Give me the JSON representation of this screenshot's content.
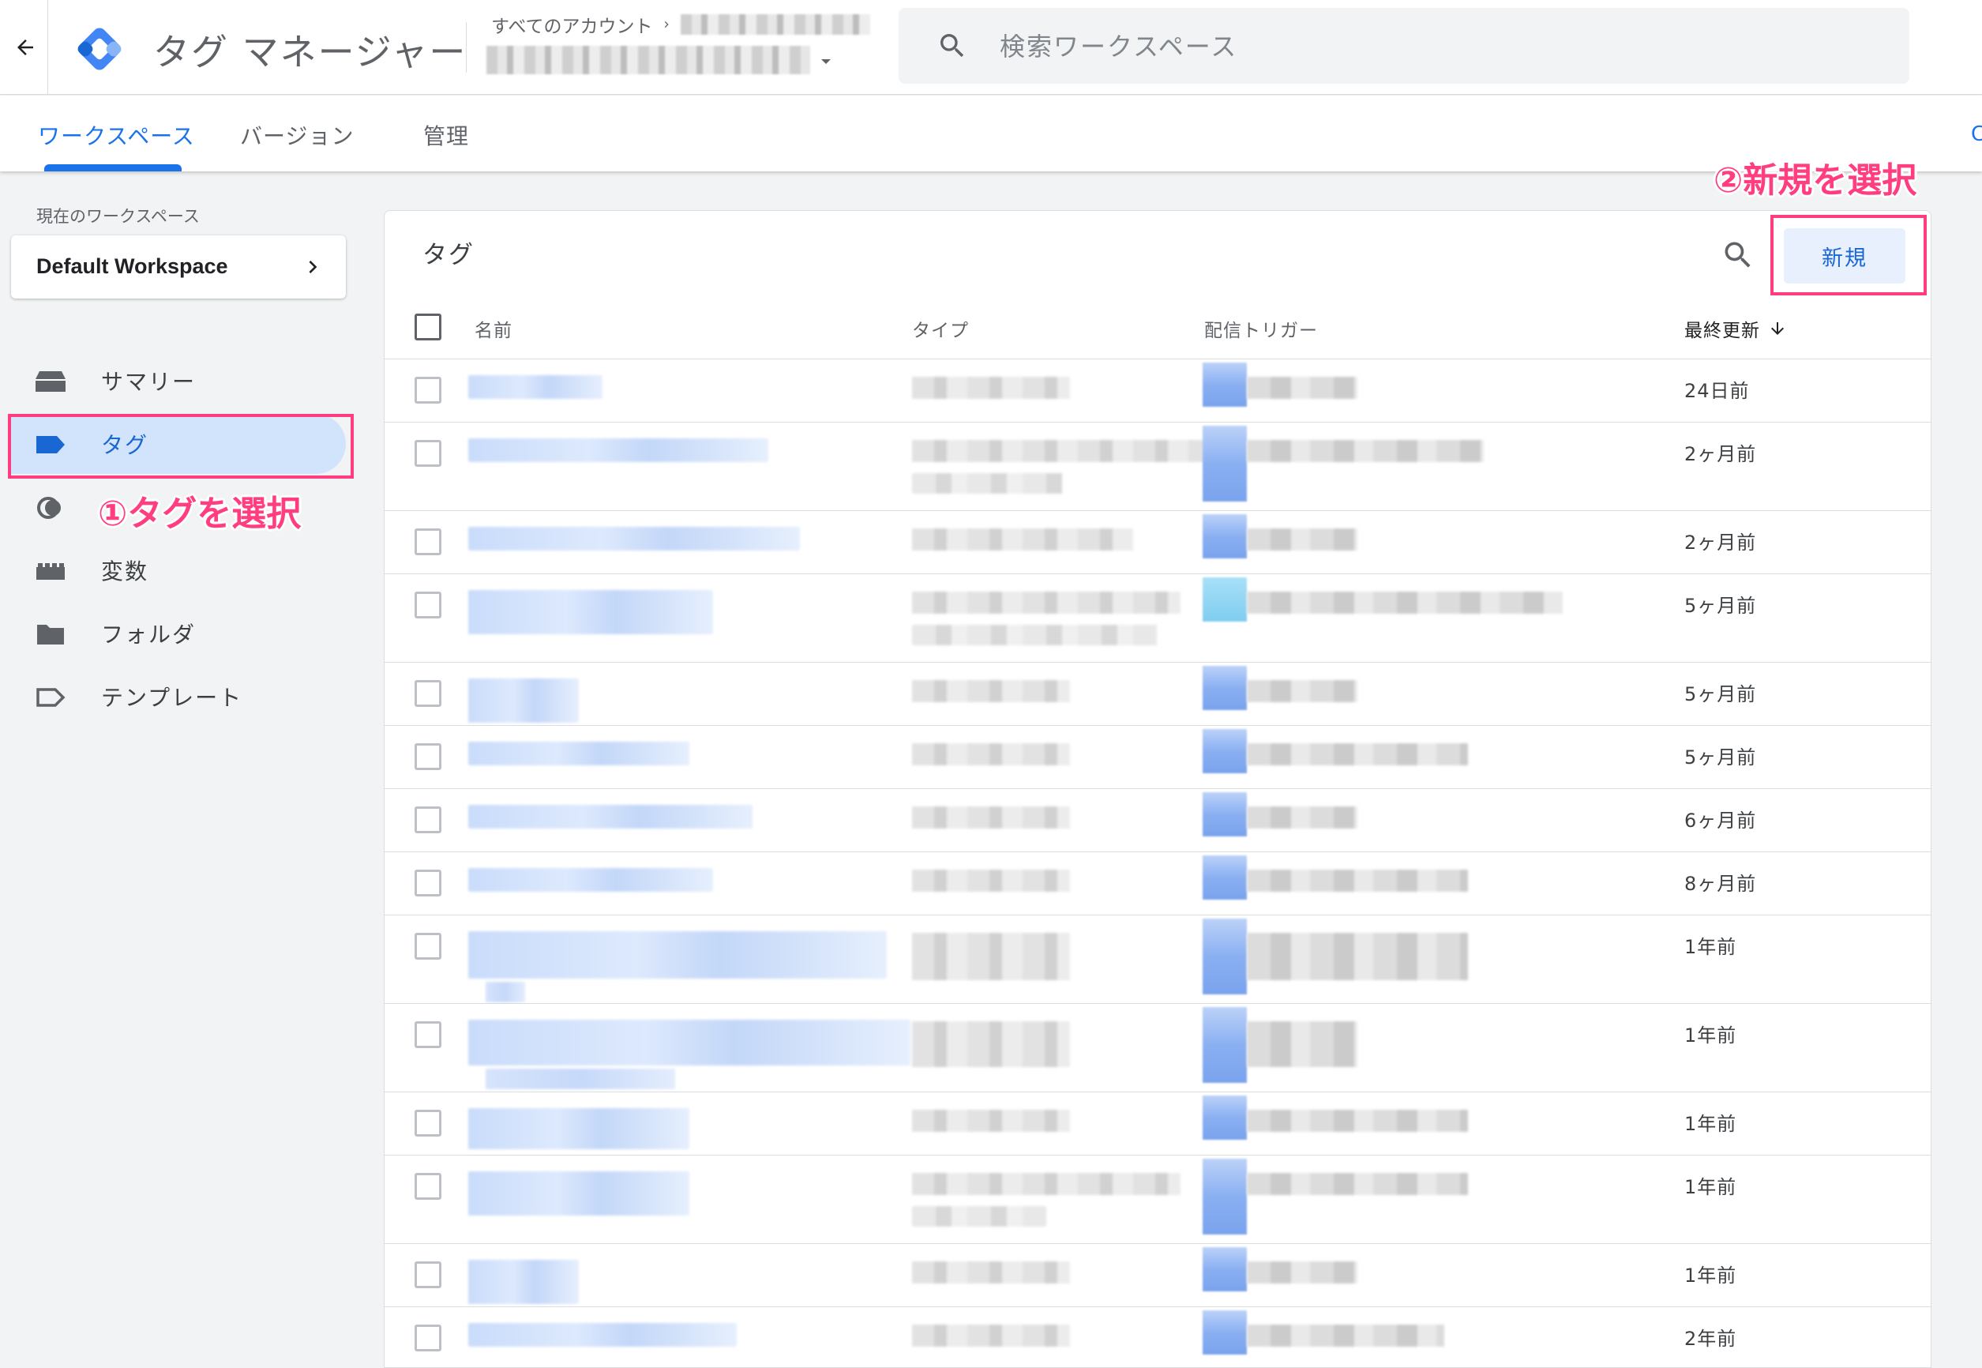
{
  "header": {
    "product_title": "タグ マネージャー",
    "breadcrumb_root": "すべてのアカウント",
    "search_placeholder": "検索ワークスペース"
  },
  "tabs": [
    {
      "label": "ワークスペース",
      "active": true
    },
    {
      "label": "バージョン",
      "active": false
    },
    {
      "label": "管理",
      "active": false
    }
  ],
  "sidebar": {
    "current_workspace_label": "現在のワークスペース",
    "workspace_name": "Default Workspace",
    "items": [
      {
        "label": "サマリー",
        "icon": "summary-icon",
        "active": false
      },
      {
        "label": "タグ",
        "icon": "tag-icon",
        "active": true
      },
      {
        "label": "トリガー",
        "icon": "trigger-icon",
        "active": false
      },
      {
        "label": "変数",
        "icon": "variables-icon",
        "active": false
      },
      {
        "label": "フォルダ",
        "icon": "folder-icon",
        "active": false
      },
      {
        "label": "テンプレート",
        "icon": "template-icon",
        "active": false
      }
    ]
  },
  "annotations": {
    "step1": "①タグを選択",
    "step2": "②新規を選択",
    "highlight_color": "#ff3d7f"
  },
  "main": {
    "card_title": "タグ",
    "new_button_label": "新規",
    "columns": {
      "name": "名前",
      "type": "タイプ",
      "trigger": "配信トリガー",
      "updated": "最終更新"
    },
    "rows": [
      {
        "updated": "24日前"
      },
      {
        "updated": "2ヶ月前"
      },
      {
        "updated": "2ヶ月前"
      },
      {
        "updated": "5ヶ月前"
      },
      {
        "updated": "5ヶ月前"
      },
      {
        "updated": "5ヶ月前"
      },
      {
        "updated": "6ヶ月前"
      },
      {
        "updated": "8ヶ月前"
      },
      {
        "updated": "1年前"
      },
      {
        "updated": "1年前"
      },
      {
        "updated": "1年前"
      },
      {
        "updated": "1年前"
      },
      {
        "updated": "1年前"
      },
      {
        "updated": "2年前"
      }
    ]
  },
  "colors": {
    "accent": "#1a73e8",
    "active_nav_bg": "#d2e3fc",
    "annotation": "#ff3d7f"
  }
}
